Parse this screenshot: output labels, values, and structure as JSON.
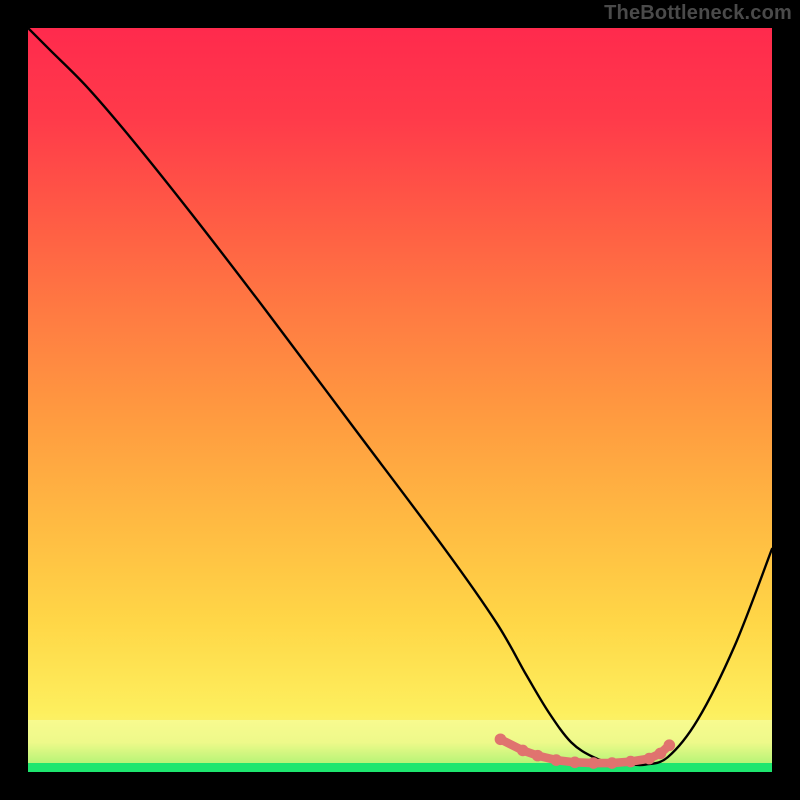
{
  "watermark": "TheBottleneck.com",
  "chart_data": {
    "type": "line",
    "title": "",
    "xlabel": "",
    "ylabel": "",
    "xlim": [
      0,
      100
    ],
    "ylim": [
      0,
      100
    ],
    "series": [
      {
        "name": "curve",
        "x": [
          0,
          3,
          8,
          14,
          22,
          32,
          44,
          56,
          63,
          67,
          70,
          73,
          76,
          79,
          81,
          83,
          86,
          90,
          95,
          100
        ],
        "y": [
          100,
          97,
          92,
          85,
          75,
          62,
          46,
          30,
          20,
          13,
          8,
          4,
          2,
          1,
          1,
          1,
          2,
          7,
          17,
          30
        ]
      }
    ],
    "marker_band": {
      "name": "optimal-range",
      "color": "#e0736f",
      "points_x": [
        63.5,
        66.5,
        68.5,
        71.0,
        73.5,
        76.0,
        78.5,
        81.0,
        83.5,
        85.0,
        86.2
      ],
      "points_y": [
        4.4,
        2.9,
        2.2,
        1.6,
        1.3,
        1.2,
        1.2,
        1.4,
        1.8,
        2.5,
        3.6
      ]
    },
    "gradient_stops": [
      {
        "pos": 0.0,
        "color": "#ff2a4d"
      },
      {
        "pos": 0.5,
        "color": "#ff9a40"
      },
      {
        "pos": 0.93,
        "color": "#f8fb8f"
      },
      {
        "pos": 0.99,
        "color": "#1ee66f"
      }
    ]
  }
}
